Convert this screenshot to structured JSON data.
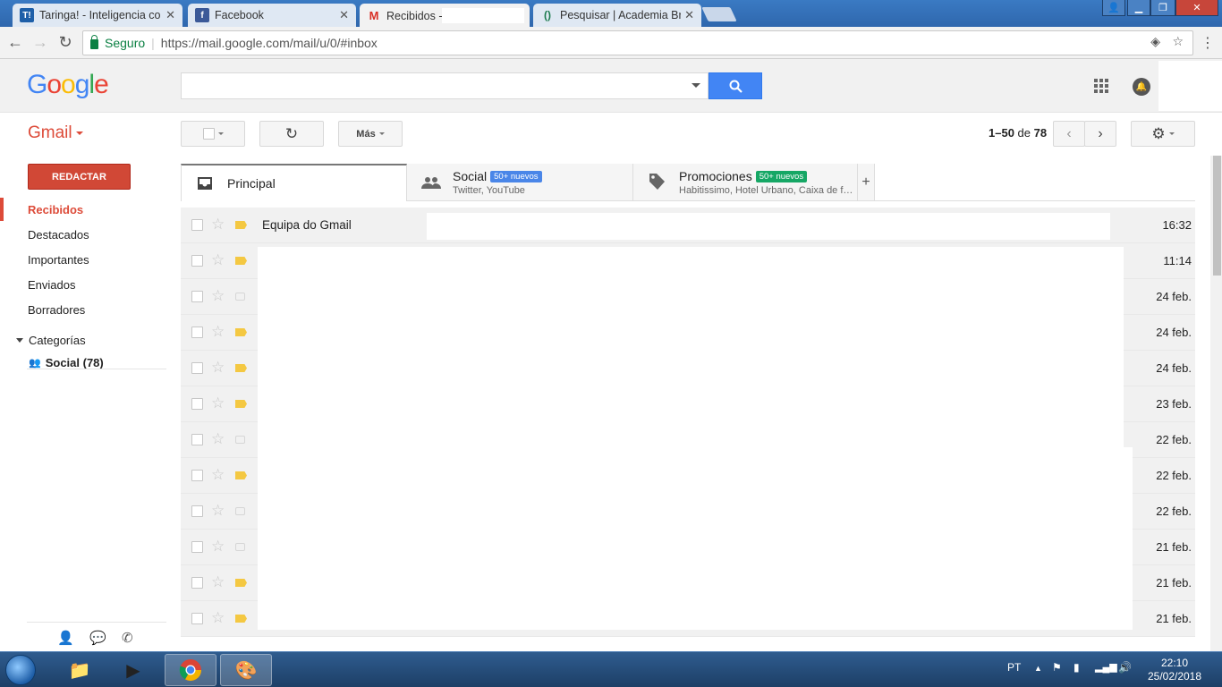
{
  "browser": {
    "tabs": [
      {
        "favicon": "T!",
        "favicon_color": "#1e5fa8",
        "title": "Taringa! - Inteligencia co"
      },
      {
        "favicon": "f",
        "favicon_color": "#3b5998",
        "title": "Facebook"
      },
      {
        "favicon": "M",
        "favicon_color": "#d93025",
        "title": "Recibidos -"
      },
      {
        "favicon": "()",
        "favicon_color": "#1b7a4e",
        "title": "Pesquisar | Academia Bra"
      }
    ],
    "secure_label": "Seguro",
    "url": "https://mail.google.com/mail/u/0/#inbox"
  },
  "header": {
    "logo_letters": [
      {
        "ch": "G",
        "color": "#4285f4"
      },
      {
        "ch": "o",
        "color": "#ea4335"
      },
      {
        "ch": "o",
        "color": "#fbbc05"
      },
      {
        "ch": "g",
        "color": "#4285f4"
      },
      {
        "ch": "l",
        "color": "#34a853"
      },
      {
        "ch": "e",
        "color": "#ea4335"
      }
    ],
    "search_value": ""
  },
  "actions": {
    "gmail_label": "Gmail",
    "more_label": "Más",
    "pager_range": "1–50",
    "pager_of": "de",
    "pager_total": "78"
  },
  "sidebar": {
    "compose_label": "REDACTAR",
    "items": [
      {
        "label": "Recibidos",
        "active": true
      },
      {
        "label": "Destacados"
      },
      {
        "label": "Importantes"
      },
      {
        "label": "Enviados"
      },
      {
        "label": "Borradores"
      }
    ],
    "categories_label": "Categorías",
    "social_label": "Social (78)"
  },
  "inbox_tabs": [
    {
      "title": "Principal",
      "subtitle": "",
      "badge": ""
    },
    {
      "title": "Social",
      "subtitle": "Twitter, YouTube",
      "badge": "50+ nuevos",
      "badge_color": "#4a86e8"
    },
    {
      "title": "Promociones",
      "subtitle": "Habitissimo, Hotel Urbano, Caixa de f…",
      "badge": "50+ nuevos",
      "badge_color": "#16a765"
    }
  ],
  "messages": [
    {
      "sender": "Equipa do Gmail",
      "date": "16:32",
      "important": true
    },
    {
      "sender": "",
      "date": "11:14",
      "important": true
    },
    {
      "sender": "",
      "date": "24 feb.",
      "important": false
    },
    {
      "sender": "",
      "date": "24 feb.",
      "important": true
    },
    {
      "sender": "",
      "date": "24 feb.",
      "important": true
    },
    {
      "sender": "",
      "date": "23 feb.",
      "important": true
    },
    {
      "sender": "",
      "date": "22 feb.",
      "important": false
    },
    {
      "sender": "",
      "date": "22 feb.",
      "important": true
    },
    {
      "sender": "",
      "date": "22 feb.",
      "important": false
    },
    {
      "sender": "",
      "date": "21 feb.",
      "important": false
    },
    {
      "sender": "",
      "date": "21 feb.",
      "important": true
    },
    {
      "sender": "",
      "date": "21 feb.",
      "important": true
    }
  ],
  "taskbar": {
    "language": "PT",
    "time": "22:10",
    "date": "25/02/2018"
  }
}
